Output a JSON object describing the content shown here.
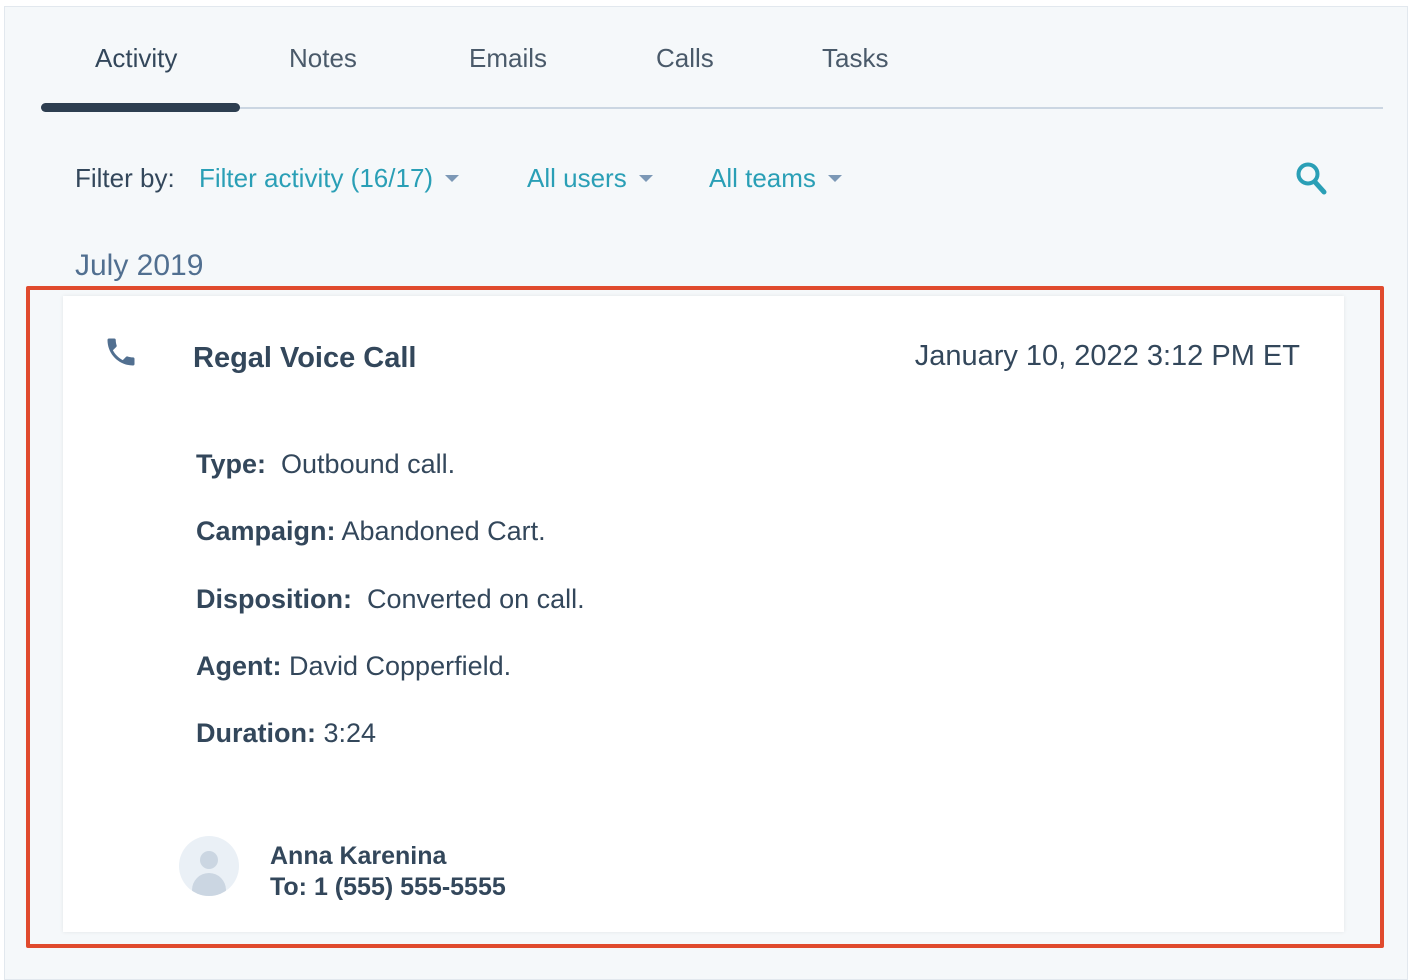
{
  "tabs": [
    {
      "label": "Activity",
      "active": true
    },
    {
      "label": "Notes",
      "active": false
    },
    {
      "label": "Emails",
      "active": false
    },
    {
      "label": "Calls",
      "active": false
    },
    {
      "label": "Tasks",
      "active": false
    }
  ],
  "filter": {
    "label": "Filter by:",
    "activity": "Filter activity (16/17)",
    "users": "All users",
    "teams": "All teams",
    "search_icon": "search-icon"
  },
  "month_heading": "July 2019",
  "activity_card": {
    "icon": "phone-icon",
    "title": "Regal Voice Call",
    "date": "January 10, 2022 3:12 PM ET",
    "details": [
      {
        "label": "Type:",
        "value": "Outbound call."
      },
      {
        "label": "Campaign:",
        "value": "Abandoned Cart."
      },
      {
        "label": "Disposition:",
        "value": "Converted on call."
      },
      {
        "label": "Agent:",
        "value": "David Copperfield."
      },
      {
        "label": "Duration:",
        "value": "3:24"
      }
    ],
    "contact": {
      "avatar_icon": "user-avatar-icon",
      "name": "Anna Karenina",
      "to": "To: 1 (555) 555-5555"
    }
  },
  "colors": {
    "accent": "#2a9fb6",
    "text": "#33475b",
    "highlight": "#e04a2d",
    "tab_indicator": "#2d3e50",
    "panel_bg": "#f5f8fa"
  }
}
